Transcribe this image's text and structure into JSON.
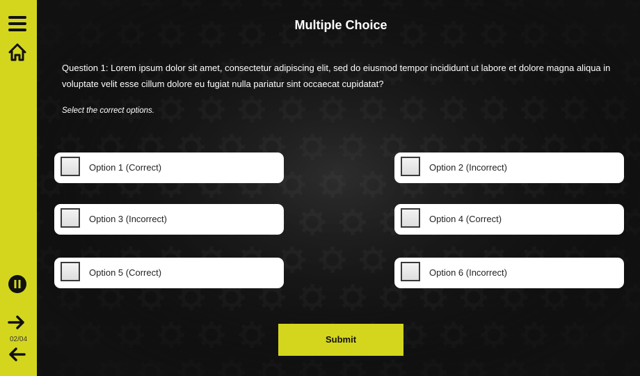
{
  "sidebar": {
    "menu_icon": "hamburger-menu-icon",
    "home_icon": "home-icon",
    "pause_icon": "pause-icon",
    "next_icon": "arrow-right-icon",
    "prev_icon": "arrow-left-icon",
    "page_counter": "02/04"
  },
  "quiz": {
    "title": "Multiple Choice",
    "question": "Question 1: Lorem ipsum dolor sit amet, consectetur adipiscing elit, sed do eiusmod tempor incididunt ut labore et dolore magna aliqua in voluptate velit esse cillum dolore eu fugiat nulla pariatur sint occaecat cupidatat?",
    "instruction": "Select the correct options.",
    "options": [
      {
        "label": "Option 1 (Correct)",
        "checked": false
      },
      {
        "label": "Option 2 (Incorrect)",
        "checked": false
      },
      {
        "label": "Option 3 (Incorrect)",
        "checked": false
      },
      {
        "label": "Option 4 (Correct)",
        "checked": false
      },
      {
        "label": "Option 5 (Correct)",
        "checked": false
      },
      {
        "label": "Option 6 (Incorrect)",
        "checked": false
      }
    ],
    "submit_label": "Submit"
  },
  "colors": {
    "accent": "#d4d61e",
    "background": "#1a1a1a",
    "option_bg": "#ffffff"
  }
}
